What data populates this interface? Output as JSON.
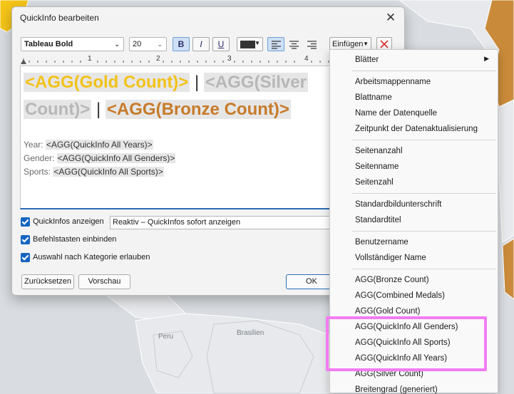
{
  "map": {
    "labels": {
      "peru": "Peru",
      "brasilien": "Brasilien"
    },
    "colors": {
      "ocean": "#d9dde1",
      "land": "#e7e9ec",
      "gold_country": "#f5c518",
      "bronze_country": "#c98b3a",
      "border": "#ffffff"
    }
  },
  "dialog": {
    "title": "QuickInfo bearbeiten",
    "close_glyph": "✕",
    "toolbar": {
      "font": "Tableau Bold",
      "size": "20",
      "bold": "B",
      "italic": "I",
      "underline": "U",
      "text_color": "#333333",
      "insert": "Einfügen",
      "delete_glyph": "✕"
    },
    "ruler": [
      "1",
      "2",
      "3",
      "4"
    ],
    "editor": {
      "gold": "<AGG(Gold Count)>",
      "sep1": "|",
      "silver_a": "<AGG(Silver",
      "silver_b": "Count)>",
      "sep2": "|",
      "bronze": "<AGG(Bronze Count)>",
      "year_label": "Year:",
      "year_value": "<AGG(QuickInfo All Years)>",
      "gender_label": "Gender:",
      "gender_value": "<AGG(QuickInfo All Genders)>",
      "sports_label": "Sports:",
      "sports_value": "<AGG(QuickInfo All Sports)>"
    },
    "options": {
      "show_tooltips": "QuickInfos anzeigen",
      "mode": "Reaktiv – QuickInfos sofort anzeigen",
      "include_commands": "Befehlstasten einbinden",
      "category_selection": "Auswahl nach Kategorie erlauben"
    },
    "buttons": {
      "reset": "Zurücksetzen",
      "preview": "Vorschau",
      "ok": "OK"
    }
  },
  "menu": {
    "sheets": "Blätter",
    "workbook_name": "Arbeitsmappenname",
    "sheet_name": "Blattname",
    "datasource_name": "Name der Datenquelle",
    "refresh_time": "Zeitpunkt der Datenaktualisierung",
    "page_count": "Seitenanzahl",
    "page_name": "Seitenname",
    "page_number": "Seitenzahl",
    "default_caption": "Standardbildunterschrift",
    "default_title": "Standardtitel",
    "username": "Benutzername",
    "full_name": "Vollständiger Name",
    "agg_bronze": "AGG(Bronze Count)",
    "agg_combined": "AGG(Combined Medals)",
    "agg_gold": "AGG(Gold Count)",
    "agg_genders": "AGG(QuickInfo All Genders)",
    "agg_sports": "AGG(QuickInfo All Sports)",
    "agg_years": "AGG(QuickInfo All Years)",
    "agg_silver": "AGG(Silver Count)",
    "latitude": "Breitengrad (generiert)"
  }
}
